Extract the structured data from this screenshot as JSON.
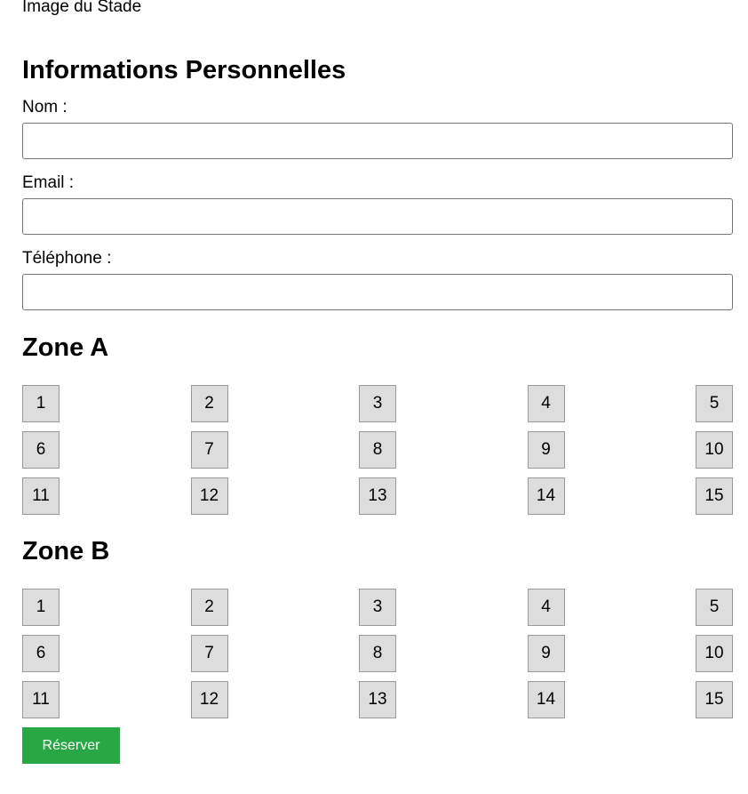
{
  "stadium_image": {
    "alt": "Image du Stade"
  },
  "personal_info": {
    "title": "Informations Personnelles",
    "fields": [
      {
        "label": "Nom :",
        "value": ""
      },
      {
        "label": "Email :",
        "value": ""
      },
      {
        "label": "Téléphone :",
        "value": ""
      }
    ]
  },
  "zones": [
    {
      "title": "Zone A",
      "seats": [
        "1",
        "2",
        "3",
        "4",
        "5",
        "6",
        "7",
        "8",
        "9",
        "10",
        "11",
        "12",
        "13",
        "14",
        "15"
      ]
    },
    {
      "title": "Zone B",
      "seats": [
        "1",
        "2",
        "3",
        "4",
        "5",
        "6",
        "7",
        "8",
        "9",
        "10",
        "11",
        "12",
        "13",
        "14",
        "15"
      ]
    }
  ],
  "reserve_button": {
    "label": "Réserver",
    "color": "#28a745"
  },
  "colors": {
    "seat_background": "#dddddd",
    "seat_border": "#9a9a9a"
  }
}
